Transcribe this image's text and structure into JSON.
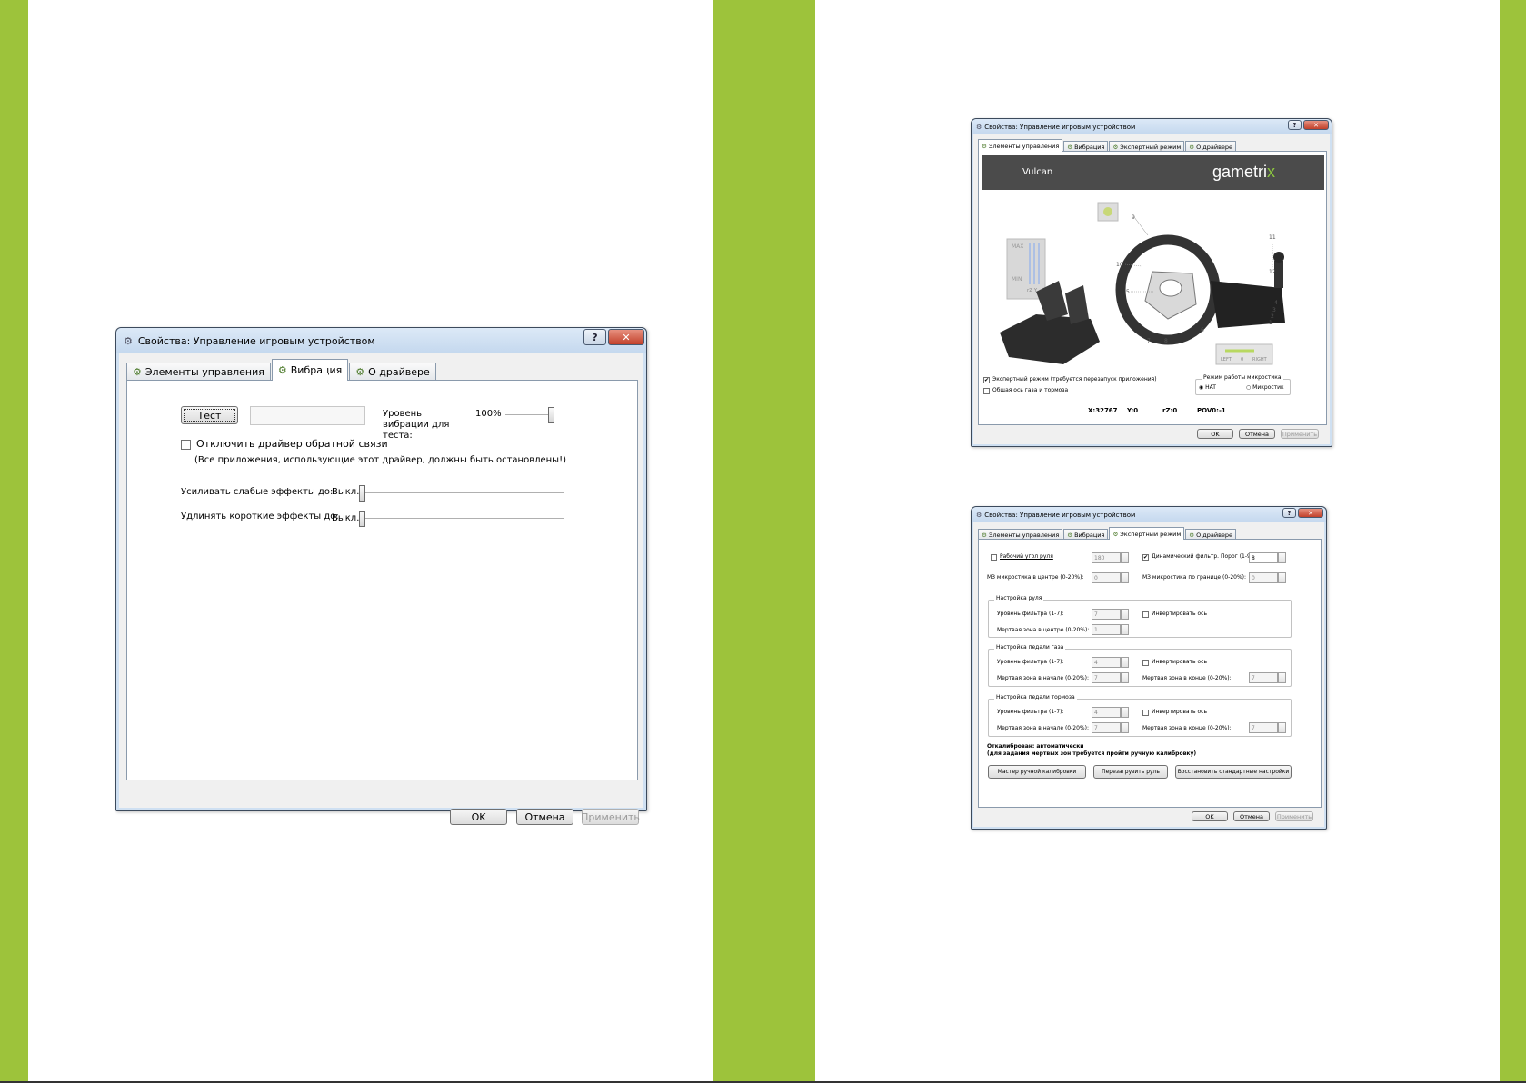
{
  "colors": {
    "accent_green": "#9dc33b",
    "banner_dark": "#4b4b4b",
    "gametrix_x": "#8cc63f"
  },
  "dialog_vibration": {
    "title": "Свойства: Управление игровым устройством",
    "help_label": "?",
    "close_label": "✕",
    "tabs": [
      {
        "label": "Элементы управления",
        "active": false
      },
      {
        "label": "Вибрация",
        "active": true
      },
      {
        "label": "О драйвере",
        "active": false
      }
    ],
    "test_button": "Тест",
    "vibration_level_label": "Уровень вибрации для теста:",
    "vibration_level_value": "100%",
    "vibration_level_fraction": 1.0,
    "disable_driver_label": "Отключить драйвер обратной связи",
    "disable_driver_checked": false,
    "disable_driver_note": "(Все приложения, использующие этот драйвер, должны быть остановлены!)",
    "amplify_label": "Усиливать слабые эффекты до:",
    "amplify_value": "Выкл.",
    "extend_label": "Удлинять короткие эффекты до:",
    "extend_value": "Выкл.",
    "ok": "OK",
    "cancel": "Отмена",
    "apply": "Применить"
  },
  "dialog_controls": {
    "title": "Свойства: Управление игровым устройством",
    "tabs": [
      {
        "label": "Элементы управления",
        "active": true
      },
      {
        "label": "Вибрация",
        "active": false
      },
      {
        "label": "Экспертный режим",
        "active": false
      },
      {
        "label": "О драйвере",
        "active": false
      }
    ],
    "banner_model": "Vulcan",
    "brand": "gametri",
    "brand_x": "x",
    "axis_max": "MAX",
    "axis_min": "MIN",
    "axis_names": "rZ  Y",
    "wheel_labels": [
      "9",
      "10",
      "11",
      "12",
      "5",
      "4",
      "3",
      "2",
      "1",
      "7",
      "8",
      "6"
    ],
    "lr_left": "LEFT",
    "lr_zero": "0",
    "lr_right": "RIGHT",
    "expert_mode_label": "Экспертный режим (требуется перезапуск приложения)",
    "expert_mode_checked": true,
    "combined_axis_label": "Общая ось газа и тормоза",
    "combined_axis_checked": false,
    "microswitch_group": "Режим работы микростика",
    "radio_hat": "HAT",
    "radio_microstick": "Микростик",
    "hat_selected": true,
    "x_value": "X:32767",
    "y_value": "Y:0",
    "rz_value": "rZ:0",
    "pov_value": "POV0:-1",
    "ok": "OK",
    "cancel": "Отмена",
    "apply": "Применить"
  },
  "dialog_expert": {
    "title": "Свойства: Управление игровым устройством",
    "tabs": [
      {
        "label": "Элементы управления",
        "active": false
      },
      {
        "label": "Вибрация",
        "active": false
      },
      {
        "label": "Экспертный режим",
        "active": true
      },
      {
        "label": "О драйвере",
        "active": false
      }
    ],
    "work_angle_label": "Рабочий угол руля",
    "work_angle_value": "180",
    "dyn_filter_label": "Динамический фильтр. Порог (1-9):",
    "dyn_filter_value": "8",
    "dz_center_label": "МЗ микростика в центре (0-20%):",
    "dz_center_value": "0",
    "dz_edge_label": "МЗ микростика по границе (0-20%):",
    "dz_edge_value": "0",
    "wheel_group": "Настройка руля",
    "wheel_filter_label": "Уровень фильтра (1-7):",
    "wheel_filter_value": "7",
    "wheel_dz_label": "Мертвая зона в центре (0-20%):",
    "wheel_dz_value": "1",
    "invert_label": "Инвертировать ось",
    "gas_group": "Настройка педали газа",
    "gas_filter_label": "Уровень фильтра (1-7):",
    "gas_filter_value": "4",
    "gas_dz_start_label": "Мертвая зона в начале (0-20%):",
    "gas_dz_start_value": "7",
    "gas_dz_end_label": "Мертвая зона в конце (0-20%):",
    "gas_dz_end_value": "7",
    "brake_group": "Настройка педали тормоза",
    "brake_filter_label": "Уровень фильтра (1-7):",
    "brake_filter_value": "4",
    "brake_dz_start_label": "Мертвая зона в начале (0-20%):",
    "brake_dz_start_value": "7",
    "brake_dz_end_label": "Мертвая зона в конце (0-20%):",
    "brake_dz_end_value": "7",
    "calibrated_line1": "Откалиброван: автоматически",
    "calibrated_line2": "(для задания мертвых зон требуется пройти ручную калибровку)",
    "manual_calibration": "Мастер ручной калибровки",
    "reload_wheel": "Перезагрузить руль",
    "restore_defaults": "Восстановить стандартные настройки",
    "ok": "OK",
    "cancel": "Отмена",
    "apply": "Применить"
  }
}
